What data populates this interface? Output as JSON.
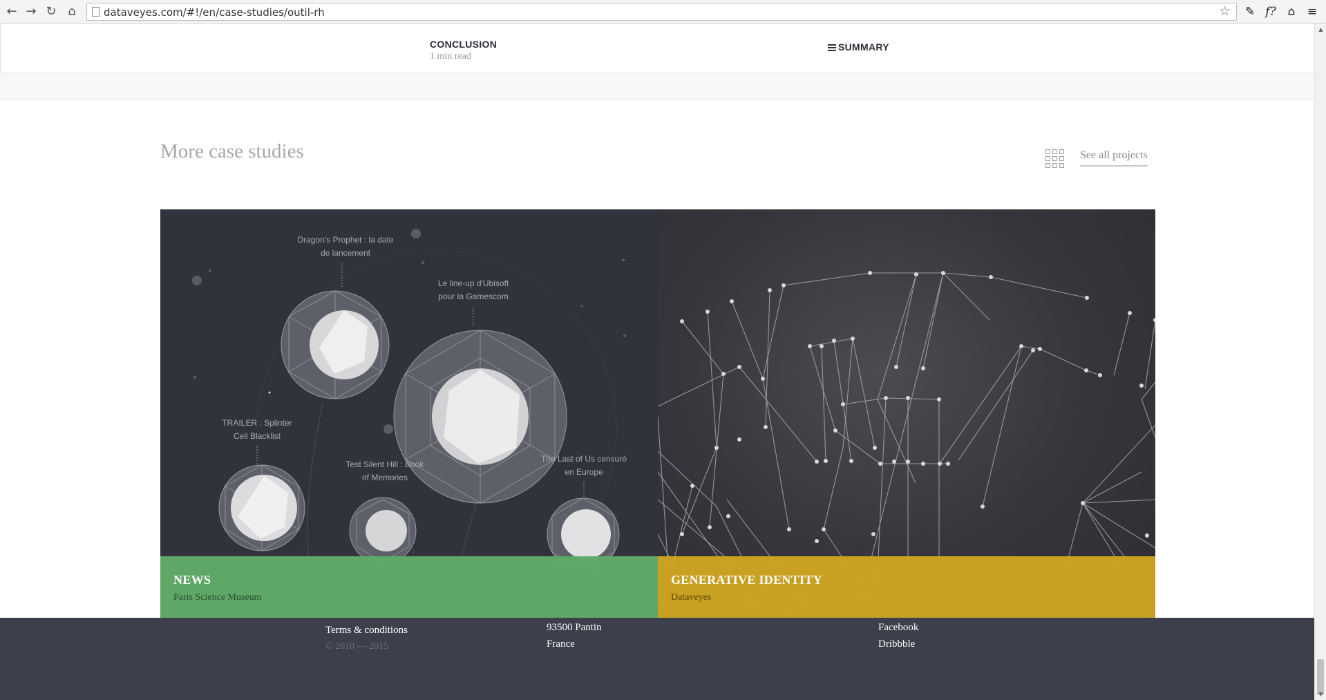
{
  "browser": {
    "url": "dataveyes.com/#!/en/case-studies/outil-rh"
  },
  "section_nav": {
    "conclusion_title": "CONCLUSION",
    "conclusion_time": "1 min read",
    "summary_label": "SUMMARY"
  },
  "more": {
    "title": "More case studies",
    "see_all": "See all projects"
  },
  "cards": [
    {
      "title": "NEWS",
      "subtitle": "Paris Science Museum",
      "band_color": "#60ac68",
      "viz_labels": [
        "Dragon's Prophet : la date\nde lancement",
        "Le line-up d'Ubisoft\npour la Gamescom",
        "TRAILER : Splinter\nCell Blacklist",
        "Test Silent Hill : Book\nof Memories",
        "The Last of Us censuré\nen Europe"
      ]
    },
    {
      "title": "GENERATIVE IDENTITY",
      "subtitle": "Dataveyes",
      "band_color": "#cea421"
    }
  ],
  "footer": {
    "terms": "Terms & conditions",
    "copyright": "© 2010 — 2015",
    "address_city": "93500 Pantin",
    "address_country": "France",
    "social_1": "Facebook",
    "social_2": "Dribbble"
  }
}
